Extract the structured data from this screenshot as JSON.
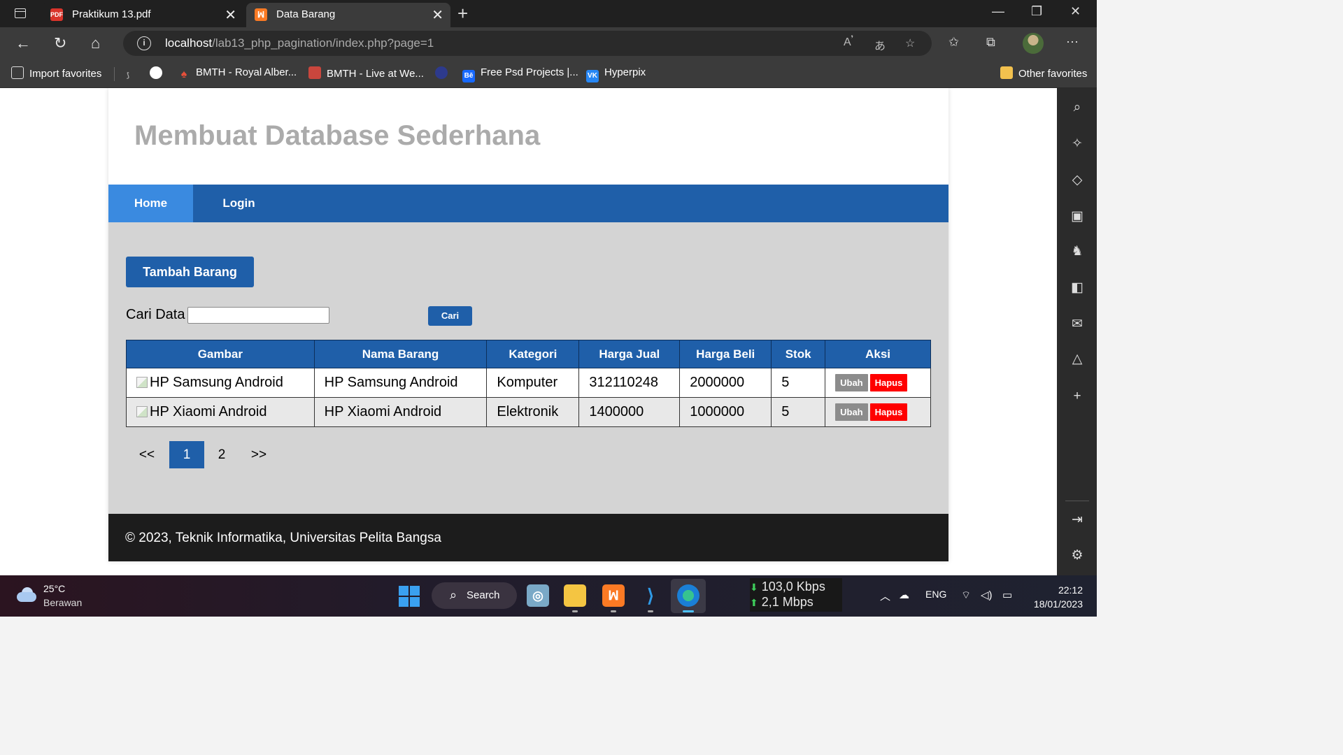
{
  "browser": {
    "tabs": [
      {
        "label": "Praktikum 13.pdf",
        "favicon": "PDF",
        "active": false
      },
      {
        "label": "Data Barang",
        "favicon": "ꟽ",
        "active": true
      }
    ],
    "new_tab": "+",
    "url_host": "localhost",
    "url_path": "/lab13_php_pagination/index.php?page=1",
    "info_icon": "i",
    "bookmarks": [
      {
        "label": "Import favorites"
      },
      {
        "label": "BMTH - Royal Alber..."
      },
      {
        "label": "BMTH - Live at We..."
      },
      {
        "label": "Free Psd Projects |..."
      },
      {
        "label": "Hyperpix"
      },
      {
        "label": "Other favorites"
      }
    ],
    "bookmark_favicon_behance": "Bē",
    "bookmark_favicon_vk": "VK"
  },
  "page": {
    "site_title": "Membuat Database Sederhana",
    "nav": {
      "home": "Home",
      "login": "Login"
    },
    "add_button": "Tambah Barang",
    "search": {
      "label": "Cari Data",
      "value": "",
      "button": "Cari"
    },
    "table": {
      "headers": [
        "Gambar",
        "Nama Barang",
        "Kategori",
        "Harga Jual",
        "Harga Beli",
        "Stok",
        "Aksi"
      ],
      "rows": [
        {
          "gambar_alt": "HP Samsung Android",
          "nama": "HP Samsung Android",
          "kategori": "Komputer",
          "harga_jual": "312110248",
          "harga_beli": "2000000",
          "stok": "5",
          "ubah": "Ubah",
          "hapus": "Hapus"
        },
        {
          "gambar_alt": "HP Xiaomi Android",
          "nama": "HP Xiaomi Android",
          "kategori": "Elektronik",
          "harga_jual": "1400000",
          "harga_beli": "1000000",
          "stok": "5",
          "ubah": "Ubah",
          "hapus": "Hapus"
        }
      ]
    },
    "pagination": {
      "prev": "<<",
      "pages": [
        "1",
        "2"
      ],
      "current": "1",
      "next": ">>"
    },
    "footer": "© 2023, Teknik Informatika, Universitas Pelita Bangsa"
  },
  "taskbar": {
    "weather_temp": "25°C",
    "weather_desc": "Berawan",
    "search": "Search",
    "xampp_glyph": "ꟽ",
    "net_down": "103,0 Kbps",
    "net_up": "2,1 Mbps",
    "lang": "ENG",
    "time": "22:12",
    "date": "18/01/2023"
  },
  "colors": {
    "nav_blue": "#1f5fa9",
    "nav_active": "#3a8ae0",
    "content_bg": "#d4d4d4",
    "delete_red": "#ff0000",
    "edit_gray": "#8c8c8c",
    "footer_bg": "#1c1c1c",
    "title_gray": "#ababab"
  }
}
